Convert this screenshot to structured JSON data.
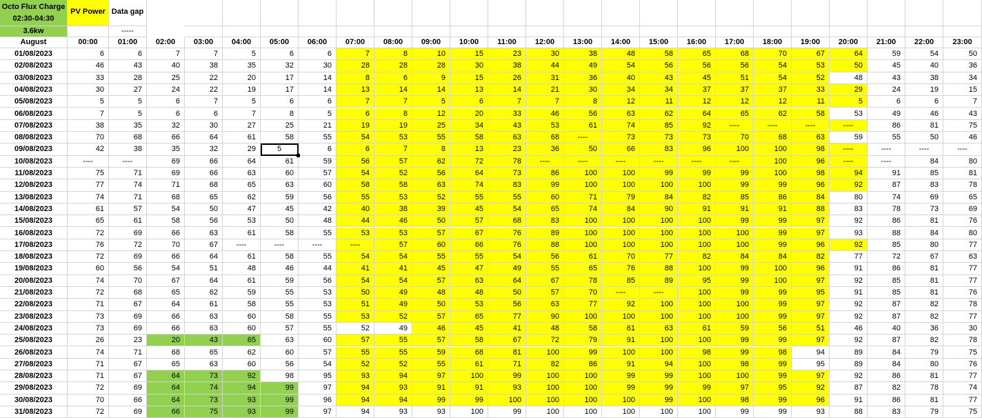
{
  "legend": {
    "charge_title": "Octo Flux Charge",
    "charge_window": "02:30-04:30",
    "charge_power": "3.6kw",
    "pv_power": "PV Power",
    "data_gap": "Data gap",
    "data_gap_marker": "-----"
  },
  "colors": {
    "pv_power": "#ffff00",
    "charge": "#92d050"
  },
  "selected_cell": "F9",
  "header": {
    "month": "August",
    "hours": [
      "00:00",
      "01:00",
      "02:00",
      "03:00",
      "04:00",
      "05:00",
      "06:00",
      "07:00",
      "08:00",
      "09:00",
      "10:00",
      "11:00",
      "12:00",
      "13:00",
      "14:00",
      "15:00",
      "16:00",
      "17:00",
      "18:00",
      "19:00",
      "20:00",
      "21:00",
      "22:00",
      "23:00"
    ]
  },
  "rows": [
    {
      "date": "01/08/2023",
      "v": [
        "6",
        "6",
        "7",
        "7",
        "5",
        "6",
        "6",
        "7",
        "8",
        "10",
        "15",
        "23",
        "30",
        "38",
        "48",
        "58",
        "65",
        "68",
        "70",
        "67",
        "64",
        "59",
        "54",
        "50"
      ],
      "y": [
        7,
        20
      ]
    },
    {
      "date": "02/08/2023",
      "v": [
        "46",
        "43",
        "40",
        "38",
        "35",
        "32",
        "30",
        "28",
        "28",
        "28",
        "30",
        "38",
        "44",
        "49",
        "54",
        "56",
        "56",
        "56",
        "54",
        "53",
        "50",
        "45",
        "40",
        "36"
      ],
      "y": [
        7,
        20
      ]
    },
    {
      "date": "03/08/2023",
      "v": [
        "33",
        "28",
        "25",
        "22",
        "20",
        "17",
        "14",
        "8",
        "6",
        "9",
        "15",
        "26",
        "31",
        "36",
        "40",
        "43",
        "45",
        "51",
        "54",
        "52",
        "48",
        "43",
        "38",
        "34"
      ],
      "y": [
        7,
        19
      ]
    },
    {
      "date": "04/08/2023",
      "v": [
        "30",
        "27",
        "24",
        "22",
        "19",
        "17",
        "14",
        "13",
        "14",
        "14",
        "13",
        "14",
        "21",
        "30",
        "34",
        "34",
        "37",
        "37",
        "37",
        "33",
        "29",
        "24",
        "19",
        "15"
      ],
      "y": [
        7,
        20
      ]
    },
    {
      "date": "05/08/2023",
      "v": [
        "5",
        "5",
        "6",
        "7",
        "5",
        "6",
        "6",
        "7",
        "7",
        "5",
        "6",
        "7",
        "7",
        "8",
        "12",
        "11",
        "12",
        "12",
        "12",
        "11",
        "5",
        "6",
        "6",
        "7"
      ],
      "y": [
        7,
        20
      ]
    },
    {
      "date": "06/08/2023",
      "v": [
        "7",
        "5",
        "6",
        "6",
        "7",
        "8",
        "5",
        "6",
        "8",
        "12",
        "20",
        "33",
        "46",
        "56",
        "63",
        "62",
        "64",
        "65",
        "62",
        "58",
        "53",
        "49",
        "46",
        "43"
      ],
      "y": [
        7,
        19
      ]
    },
    {
      "date": "07/08/2023",
      "v": [
        "38",
        "35",
        "32",
        "30",
        "27",
        "25",
        "21",
        "19",
        "19",
        "25",
        "34",
        "43",
        "53",
        "61",
        "74",
        "85",
        "92",
        "----",
        "----",
        "----",
        "----",
        "86",
        "81",
        "75"
      ],
      "y": [
        7,
        20
      ]
    },
    {
      "date": "08/08/2023",
      "v": [
        "70",
        "68",
        "66",
        "64",
        "61",
        "58",
        "55",
        "54",
        "53",
        "55",
        "58",
        "63",
        "68",
        "----",
        "73",
        "73",
        "73",
        "70",
        "68",
        "63",
        "59",
        "55",
        "50",
        "46"
      ],
      "y": [
        7,
        19
      ]
    },
    {
      "date": "09/08/2023",
      "v": [
        "42",
        "38",
        "35",
        "32",
        "29",
        "5",
        "6",
        "6",
        "7",
        "8",
        "13",
        "23",
        "36",
        "50",
        "66",
        "83",
        "96",
        "100",
        "100",
        "98",
        "----",
        "----",
        "----",
        "----"
      ],
      "y": [
        7,
        20
      ]
    },
    {
      "date": "10/08/2023",
      "v": [
        "----",
        "----",
        "69",
        "66",
        "64",
        "61",
        "59",
        "56",
        "57",
        "62",
        "72",
        "78",
        "----",
        "----",
        "----",
        "----",
        "----",
        "----",
        "100",
        "96",
        "----",
        "----",
        "84",
        "80"
      ],
      "y": [
        7,
        20
      ]
    },
    {
      "date": "11/08/2023",
      "v": [
        "75",
        "71",
        "69",
        "66",
        "63",
        "60",
        "57",
        "54",
        "52",
        "56",
        "64",
        "73",
        "86",
        "100",
        "100",
        "99",
        "99",
        "99",
        "100",
        "98",
        "94",
        "91",
        "85",
        "81"
      ],
      "y": [
        7,
        20
      ]
    },
    {
      "date": "12/08/2023",
      "v": [
        "77",
        "74",
        "71",
        "68",
        "65",
        "63",
        "60",
        "58",
        "58",
        "63",
        "74",
        "83",
        "99",
        "100",
        "100",
        "100",
        "100",
        "99",
        "99",
        "96",
        "92",
        "87",
        "83",
        "78"
      ],
      "y": [
        7,
        20
      ]
    },
    {
      "date": "13/08/2023",
      "v": [
        "74",
        "71",
        "68",
        "65",
        "62",
        "59",
        "56",
        "55",
        "53",
        "52",
        "55",
        "55",
        "60",
        "71",
        "79",
        "84",
        "82",
        "85",
        "86",
        "84",
        "80",
        "74",
        "69",
        "65"
      ],
      "y": [
        7,
        19
      ]
    },
    {
      "date": "14/08/2023",
      "v": [
        "61",
        "57",
        "54",
        "50",
        "47",
        "45",
        "42",
        "40",
        "38",
        "39",
        "45",
        "54",
        "65",
        "74",
        "84",
        "90",
        "91",
        "91",
        "91",
        "88",
        "83",
        "78",
        "73",
        "69"
      ],
      "y": [
        7,
        19
      ]
    },
    {
      "date": "15/08/2023",
      "v": [
        "65",
        "61",
        "58",
        "56",
        "53",
        "50",
        "48",
        "44",
        "46",
        "50",
        "57",
        "68",
        "83",
        "100",
        "100",
        "100",
        "100",
        "99",
        "99",
        "97",
        "92",
        "86",
        "81",
        "76"
      ],
      "y": [
        7,
        19
      ]
    },
    {
      "date": "16/08/2023",
      "v": [
        "72",
        "69",
        "66",
        "63",
        "61",
        "58",
        "55",
        "53",
        "53",
        "57",
        "67",
        "76",
        "89",
        "100",
        "100",
        "100",
        "100",
        "100",
        "99",
        "97",
        "93",
        "88",
        "84",
        "80"
      ],
      "y": [
        7,
        19
      ]
    },
    {
      "date": "17/08/2023",
      "v": [
        "76",
        "72",
        "70",
        "67",
        "----",
        "----",
        "----",
        "----",
        "57",
        "60",
        "66",
        "76",
        "88",
        "100",
        "100",
        "100",
        "100",
        "100",
        "99",
        "96",
        "92",
        "85",
        "80",
        "77"
      ],
      "y": [
        7,
        20
      ]
    },
    {
      "date": "18/08/2023",
      "v": [
        "72",
        "69",
        "66",
        "64",
        "61",
        "58",
        "55",
        "54",
        "54",
        "55",
        "55",
        "54",
        "56",
        "61",
        "70",
        "77",
        "82",
        "84",
        "84",
        "82",
        "77",
        "72",
        "67",
        "63"
      ],
      "y": [
        7,
        19
      ]
    },
    {
      "date": "19/08/2023",
      "v": [
        "60",
        "56",
        "54",
        "51",
        "48",
        "46",
        "44",
        "41",
        "41",
        "45",
        "47",
        "49",
        "55",
        "65",
        "76",
        "88",
        "100",
        "99",
        "100",
        "96",
        "91",
        "86",
        "81",
        "77"
      ],
      "y": [
        7,
        19
      ]
    },
    {
      "date": "20/08/2023",
      "v": [
        "74",
        "70",
        "67",
        "64",
        "61",
        "59",
        "56",
        "54",
        "54",
        "57",
        "63",
        "64",
        "67",
        "78",
        "85",
        "89",
        "95",
        "99",
        "100",
        "97",
        "92",
        "85",
        "81",
        "77"
      ],
      "y": [
        7,
        19
      ]
    },
    {
      "date": "21/08/2023",
      "v": [
        "72",
        "68",
        "65",
        "62",
        "59",
        "55",
        "53",
        "50",
        "49",
        "48",
        "48",
        "50",
        "57",
        "70",
        "----",
        "----",
        "100",
        "99",
        "99",
        "95",
        "91",
        "85",
        "81",
        "76"
      ],
      "y": [
        7,
        19
      ]
    },
    {
      "date": "22/08/2023",
      "v": [
        "71",
        "67",
        "64",
        "61",
        "58",
        "55",
        "53",
        "51",
        "49",
        "50",
        "53",
        "56",
        "63",
        "77",
        "92",
        "100",
        "100",
        "100",
        "99",
        "97",
        "92",
        "87",
        "82",
        "78"
      ],
      "y": [
        7,
        19
      ]
    },
    {
      "date": "23/08/2023",
      "v": [
        "73",
        "69",
        "66",
        "63",
        "60",
        "58",
        "55",
        "53",
        "52",
        "57",
        "65",
        "77",
        "90",
        "100",
        "100",
        "100",
        "100",
        "100",
        "99",
        "97",
        "92",
        "87",
        "82",
        "77"
      ],
      "y": [
        7,
        19
      ]
    },
    {
      "date": "24/08/2023",
      "v": [
        "73",
        "69",
        "66",
        "63",
        "60",
        "57",
        "55",
        "52",
        "49",
        "46",
        "45",
        "41",
        "48",
        "58",
        "61",
        "63",
        "61",
        "59",
        "56",
        "51",
        "46",
        "40",
        "36",
        "30"
      ],
      "y": [
        9,
        19
      ]
    },
    {
      "date": "25/08/2023",
      "v": [
        "26",
        "23",
        "20",
        "43",
        "65",
        "63",
        "60",
        "57",
        "55",
        "57",
        "58",
        "67",
        "72",
        "79",
        "91",
        "100",
        "100",
        "99",
        "99",
        "97",
        "92",
        "87",
        "82",
        "78"
      ],
      "y": [
        7,
        19
      ],
      "g": [
        2,
        4
      ]
    },
    {
      "date": "26/08/2023",
      "v": [
        "74",
        "71",
        "68",
        "65",
        "62",
        "60",
        "57",
        "55",
        "55",
        "59",
        "68",
        "81",
        "100",
        "99",
        "100",
        "100",
        "98",
        "99",
        "98",
        "94",
        "89",
        "84",
        "79",
        "75"
      ],
      "y": [
        7,
        18
      ]
    },
    {
      "date": "27/08/2023",
      "v": [
        "71",
        "67",
        "65",
        "63",
        "60",
        "56",
        "54",
        "52",
        "52",
        "55",
        "61",
        "71",
        "82",
        "86",
        "91",
        "94",
        "100",
        "98",
        "99",
        "95",
        "89",
        "84",
        "80",
        "76"
      ],
      "y": [
        7,
        18
      ]
    },
    {
      "date": "28/08/2023",
      "v": [
        "71",
        "67",
        "64",
        "73",
        "92",
        "98",
        "95",
        "93",
        "94",
        "97",
        "100",
        "99",
        "100",
        "100",
        "99",
        "99",
        "100",
        "100",
        "99",
        "97",
        "92",
        "86",
        "81",
        "77"
      ],
      "y": [
        7,
        19
      ],
      "g": [
        2,
        4
      ]
    },
    {
      "date": "29/08/2023",
      "v": [
        "72",
        "69",
        "64",
        "74",
        "94",
        "99",
        "97",
        "94",
        "93",
        "91",
        "91",
        "93",
        "100",
        "100",
        "99",
        "99",
        "99",
        "97",
        "95",
        "92",
        "87",
        "82",
        "78",
        "74"
      ],
      "y": [
        7,
        19
      ],
      "g": [
        2,
        5
      ]
    },
    {
      "date": "30/08/2023",
      "v": [
        "70",
        "66",
        "64",
        "73",
        "93",
        "99",
        "96",
        "94",
        "94",
        "99",
        "99",
        "100",
        "100",
        "100",
        "100",
        "99",
        "100",
        "98",
        "99",
        "96",
        "91",
        "86",
        "81",
        "77"
      ],
      "y": [
        7,
        19
      ],
      "g": [
        2,
        5
      ]
    },
    {
      "date": "31/08/2023",
      "v": [
        "72",
        "69",
        "66",
        "75",
        "93",
        "99",
        "97",
        "94",
        "93",
        "93",
        "100",
        "99",
        "100",
        "100",
        "100",
        "100",
        "100",
        "99",
        "99",
        "93",
        "88",
        "83",
        "79",
        "75"
      ],
      "y": [
        -1,
        -1
      ],
      "g": [
        2,
        5
      ]
    }
  ]
}
